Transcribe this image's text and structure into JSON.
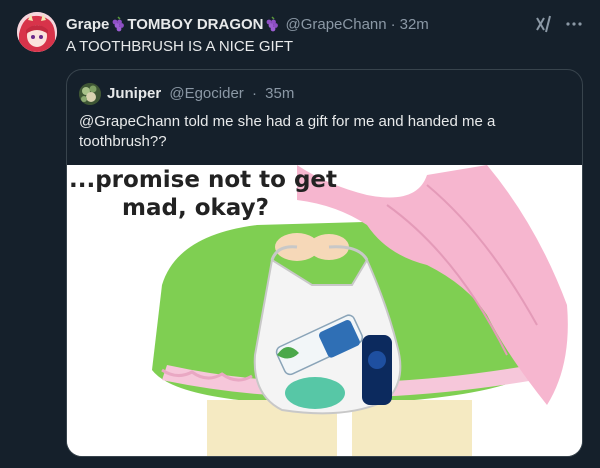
{
  "tweet": {
    "author": {
      "name_part1": "Grape",
      "name_part2": "TOMBOY DRAGON",
      "handle": "@GrapeChann",
      "separator": "·",
      "time": "32m"
    },
    "text": "A TOOTHBRUSH IS A NICE GIFT",
    "quote": {
      "author_name": "Juniper",
      "handle": "@Egocider",
      "separator": "·",
      "time": "35m",
      "text": "@GrapeChann  told me she had a gift for me and handed me a toothbrush??",
      "media": {
        "caption_line1": "...promise not to get",
        "caption_line2": "mad, okay?"
      }
    }
  },
  "colors": {
    "background": "#15202b",
    "text": "#e7e9ea",
    "secondary_text": "#8b98a5",
    "border": "#38444d"
  }
}
